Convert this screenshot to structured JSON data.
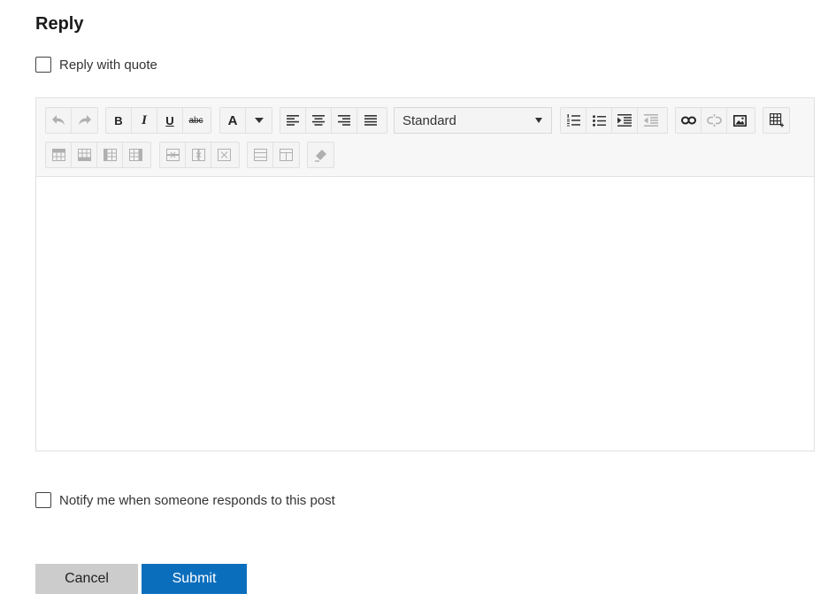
{
  "header": {
    "title": "Reply"
  },
  "quote_option": {
    "label": "Reply with quote",
    "checked": false
  },
  "editor": {
    "format_select": {
      "value": "Standard"
    },
    "font_color_label": "A",
    "formatting": {
      "bold": "B",
      "italic": "I",
      "underline": "U",
      "strikethrough": "abc"
    },
    "body_text": ""
  },
  "notify_option": {
    "label": "Notify me when someone responds to this post",
    "checked": false
  },
  "actions": {
    "cancel_label": "Cancel",
    "submit_label": "Submit"
  },
  "colors": {
    "submit": "#0a6ebd",
    "cancel": "#cccccc",
    "toolbar_bg": "#f7f7f7"
  }
}
